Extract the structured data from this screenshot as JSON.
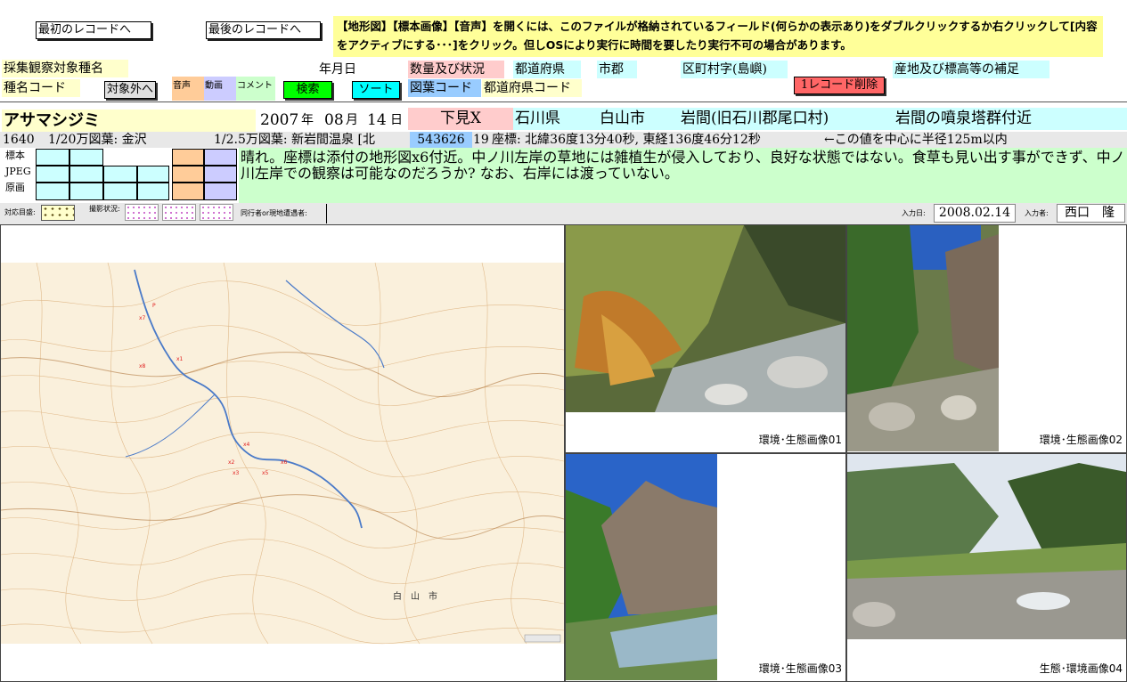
{
  "nav": {
    "first_record": "最初のレコードへ",
    "last_record": "最後のレコードへ"
  },
  "notice": "【地形図】【標本画像】【音声】を開くには、このファイルが格納されているフィールド(何らかの表示あり)をダブルクリックするか右クリックして[内容をアクティブにする･･･]をクリック。但しOSにより実行に時間を要したり実行不可の場合があります。",
  "headers": {
    "species_target": "採集観察対象種名",
    "species_code": "種名コード",
    "not_target_button": "対象外へ",
    "audio": "音声",
    "video": "動画",
    "comment": "コメント",
    "search_button": "検索",
    "sort_button": "ソート",
    "date": "年月日",
    "quantity_status": "数量及び状況",
    "map_code": "図葉コード",
    "prefecture": "都道府県",
    "prefecture_code": "都道府県コード",
    "city": "市郡",
    "ward_village": "区町村字(島嶼)",
    "locality_supplement": "産地及び標高等の補足",
    "delete_button": "1レコード削除"
  },
  "record": {
    "species_name": "アサマシジミ",
    "year": "2007",
    "year_unit": "年",
    "month": "08",
    "month_unit": "月",
    "day": "14",
    "day_unit": "日",
    "quantity": "下見X",
    "prefecture": "石川県",
    "city": "白山市",
    "village": "岩間(旧石川郡尾口村)",
    "locality": "岩間の噴泉塔群付近",
    "species_code": "1640",
    "map_200k": "1/20万図葉: 金沢",
    "map_25k": "1/2.5万図葉: 新岩間温泉 [北",
    "map_code": "543626",
    "pref_code": "19",
    "coords": "座標: 北緯36度13分40秒, 東経136度46分12秒",
    "radius_note": "←この値を中心に半径125m以内",
    "description": "晴れ。座標は添付の地形図x6付近。中ノ川左岸の草地には雑植生が侵入しており、良好な状態ではない。食草も見い出す事ができず、中ノ川左岸での観察は可能なのだろうか? なお、右岸には渡っていない。"
  },
  "media_labels": {
    "specimen": "標本",
    "jpeg": "JPEG",
    "original": "原画"
  },
  "strip": {
    "target_eye": "対応目盛:",
    "photo_status": "撮影状況:",
    "companions": "同行者or現地遭遇者:",
    "entry_date_label": "入力日:",
    "entry_date": "2008.02.14",
    "entry_person_label": "入力者:",
    "entry_person": "西口　隆"
  },
  "map": {
    "city_label": "白　山　市",
    "markers": [
      "x1",
      "x2",
      "x3",
      "x4",
      "x5",
      "x6",
      "x7",
      "x8",
      "P"
    ]
  },
  "photos": [
    {
      "caption": "環境･生態画像01"
    },
    {
      "caption": "環境･生態画像02"
    },
    {
      "caption": "環境･生態画像03"
    },
    {
      "caption": "生態･環境画像04"
    }
  ],
  "colors": {
    "yellow_label": "#ffffcc",
    "cyan_label": "#ccffff",
    "pink_label": "#ffcccc",
    "green_desc": "#ccffcc",
    "search_green": "#00ff00",
    "sort_cyan": "#00ffff",
    "delete_red": "#ff6666"
  }
}
